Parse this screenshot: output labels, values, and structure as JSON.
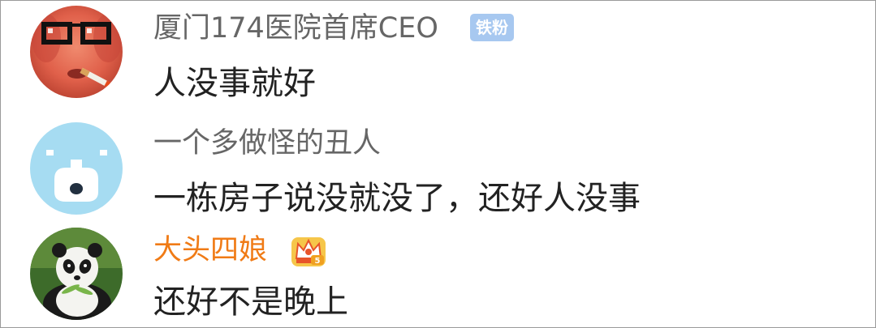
{
  "comments": [
    {
      "username": "厦门174医院首席CEO",
      "badge": "铁粉",
      "badge_color": "#a7c8f0",
      "text": "人没事就好",
      "avatar": "face-with-glasses-and-cigarette"
    },
    {
      "username": "一个多做怪的丑人",
      "text": "一栋房子说没就没了，还好人没事",
      "avatar": "light-blue-cartoon-face"
    },
    {
      "username": "大头四娘",
      "username_color": "#f07b16",
      "badge_icon": "crown-icon",
      "text": "还好不是晚上",
      "avatar": "panda-photo"
    }
  ]
}
